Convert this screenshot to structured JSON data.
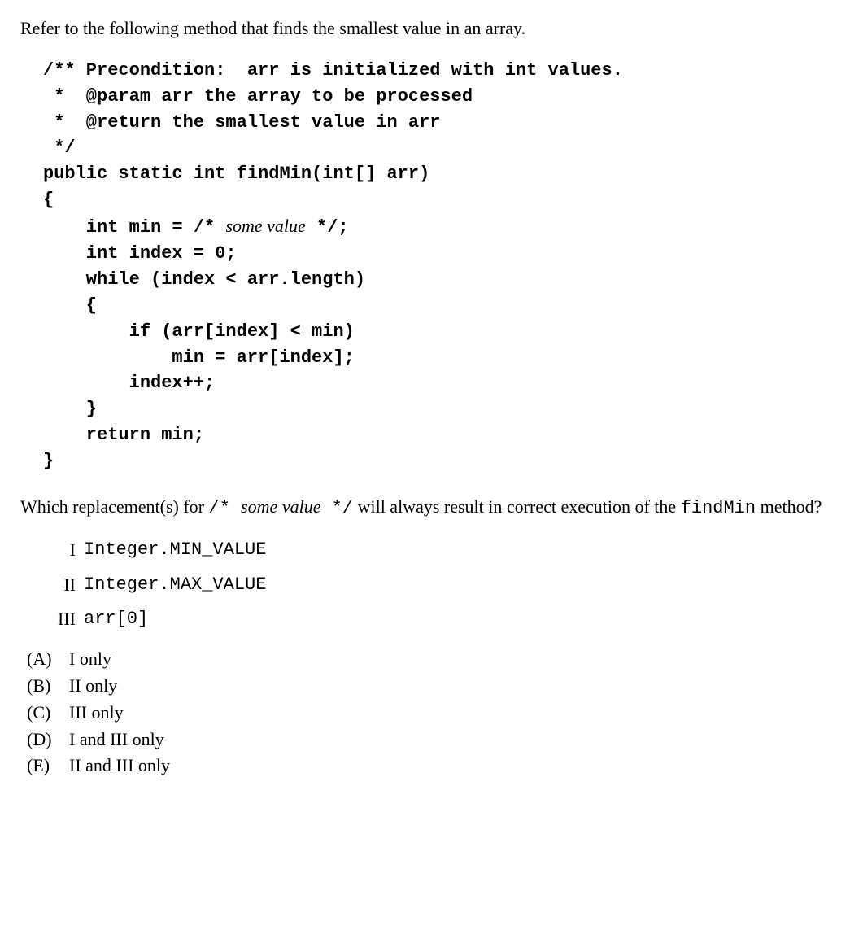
{
  "intro": "Refer to the following method that finds the smallest value in an array.",
  "code": {
    "line1": "/** Precondition:  arr is initialized with int values.",
    "line2": " *  @param arr the array to be processed",
    "line3": " *  @return the smallest value in arr",
    "line4": " */",
    "line5": "public static int findMin(int[] arr)",
    "line6": "{",
    "line7a": "    int min = /* ",
    "line7b": "some value",
    "line7c": " */;",
    "line8": "    int index = 0;",
    "line9": "    while (index < arr.length)",
    "line10": "    {",
    "line11": "        if (arr[index] < min)",
    "line12": "            min = arr[index];",
    "line13": "        index++;",
    "line14": "    }",
    "line15": "    return min;",
    "line16": "}"
  },
  "question": {
    "part1": "Which replacement(s) for ",
    "code1": "/* ",
    "italic1": "some value",
    "code2": " */",
    "part2": " will always result in correct execu",
    "part3": "tion of the ",
    "code3": "findMin",
    "part4": " method?"
  },
  "roman": {
    "i_label": "I",
    "i_content": "Integer.MIN_VALUE",
    "ii_label": "II",
    "ii_content": "Integer.MAX_VALUE",
    "iii_label": "III",
    "iii_content": "arr[0]"
  },
  "answers": {
    "a_label": "(A)",
    "a_content": "I only",
    "b_label": "(B)",
    "b_content": "II only",
    "c_label": "(C)",
    "c_content": "III only",
    "d_label": "(D)",
    "d_content": "I and III only",
    "e_label": "(E)",
    "e_content": "II and III only"
  }
}
